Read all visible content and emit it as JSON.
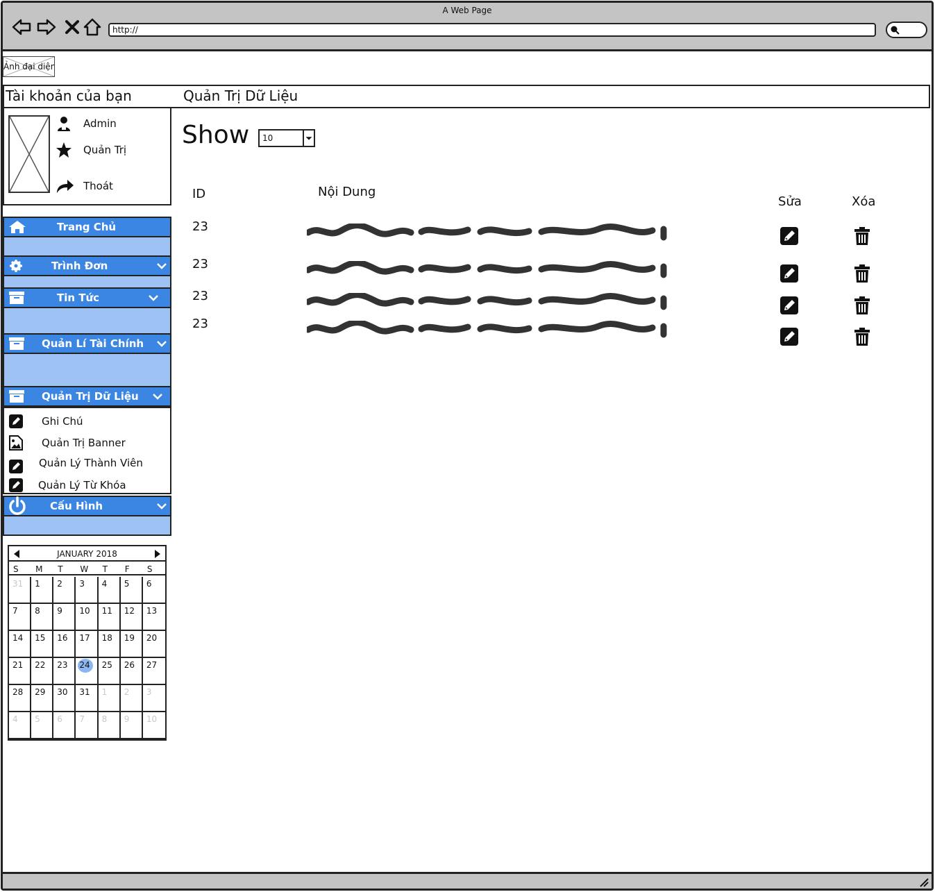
{
  "window": {
    "title": "A Web Page",
    "url": "http://"
  },
  "header": {
    "avatar_label": "Ảnh đại diện",
    "account_title": "Tài khoản của bạn",
    "page_title": "Quản Trị Dữ Liệu"
  },
  "profile": {
    "items": [
      {
        "label": "Admin",
        "icon": "user-icon"
      },
      {
        "label": "Quản Trị",
        "icon": "star-icon"
      },
      {
        "label": "Thoát",
        "icon": "share-arrow-icon"
      }
    ]
  },
  "sidebar": {
    "menus": [
      {
        "label": "Trang Chủ",
        "icon": "home-icon"
      },
      {
        "label": "Trình Đơn",
        "icon": "gear-icon"
      },
      {
        "label": "Tin Tức",
        "icon": "archive-icon"
      },
      {
        "label": "Quản Lí Tài Chính",
        "icon": "archive-icon"
      },
      {
        "label": "Quản Trị Dữ Liệu",
        "icon": "archive-icon"
      },
      {
        "label": "Cấu Hình",
        "icon": "power-icon"
      }
    ],
    "submenu": [
      {
        "label": "Ghi Chú",
        "icon": "edit-icon"
      },
      {
        "label": "Quản Trị Banner",
        "icon": "image-file-icon"
      },
      {
        "label": "Quản Lý Thành Viên",
        "icon": "edit-icon"
      },
      {
        "label": "Quản Lý Từ Khóa",
        "icon": "edit-icon"
      }
    ],
    "accent_color": "#3c86e3",
    "panel_color": "#9ec2f4"
  },
  "calendar": {
    "month_label": "JANUARY 2018",
    "weekdays": [
      "S",
      "M",
      "T",
      "W",
      "T",
      "F",
      "S"
    ],
    "days": [
      "31",
      "1",
      "2",
      "3",
      "4",
      "5",
      "6",
      "7",
      "8",
      "9",
      "10",
      "11",
      "12",
      "13",
      "14",
      "15",
      "16",
      "17",
      "18",
      "19",
      "20",
      "21",
      "22",
      "23",
      "24",
      "25",
      "26",
      "27",
      "28",
      "29",
      "30",
      "31",
      "1",
      "2",
      "3",
      "4",
      "5",
      "6",
      "7",
      "8",
      "9",
      "10"
    ],
    "selected_day": "24"
  },
  "main": {
    "show_label": "Show",
    "show_value": "10",
    "columns": {
      "id": "ID",
      "content": "Nội Dung",
      "edit": "Sửa",
      "delete": "Xóa"
    },
    "rows": [
      {
        "id": "23"
      },
      {
        "id": "23"
      },
      {
        "id": "23"
      },
      {
        "id": "23"
      }
    ]
  }
}
